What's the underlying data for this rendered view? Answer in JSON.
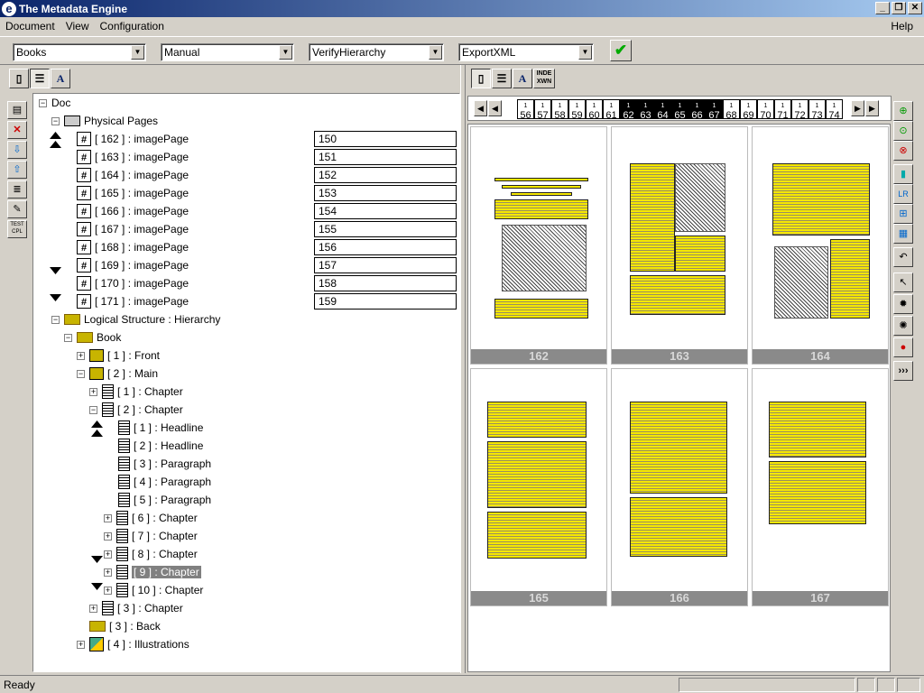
{
  "window": {
    "title": "The Metadata Engine",
    "app_icon": "e"
  },
  "menu": {
    "document": "Document",
    "view": "View",
    "configuration": "Configuration",
    "help": "Help"
  },
  "toolbar": {
    "combos": [
      {
        "value": "Books"
      },
      {
        "value": "Manual"
      },
      {
        "value": "VerifyHierarchy"
      },
      {
        "value": "ExportXML"
      }
    ]
  },
  "tree": {
    "root": "Doc",
    "physical": "Physical Pages",
    "pages": [
      {
        "label": "[ 162 ] : imagePage",
        "value": "150"
      },
      {
        "label": "[ 163 ] : imagePage",
        "value": "151"
      },
      {
        "label": "[ 164 ] : imagePage",
        "value": "152"
      },
      {
        "label": "[ 165 ] : imagePage",
        "value": "153"
      },
      {
        "label": "[ 166 ] : imagePage",
        "value": "154"
      },
      {
        "label": "[ 167 ] : imagePage",
        "value": "155"
      },
      {
        "label": "[ 168 ] : imagePage",
        "value": "156"
      },
      {
        "label": "[ 169 ] : imagePage",
        "value": "157"
      },
      {
        "label": "[ 170 ] : imagePage",
        "value": "158"
      },
      {
        "label": "[ 171 ] : imagePage",
        "value": "159"
      }
    ],
    "logical": "Logical Structure : Hierarchy",
    "book": "Book",
    "front": "[ 1 ] : Front",
    "main": "[ 2 ] : Main",
    "chapter1": "[ 1 ] : Chapter",
    "chapter2": "[ 2 ] : Chapter",
    "sub": [
      "[ 1 ] : Headline",
      "[ 2 ] : Headline",
      "[ 3 ] : Paragraph",
      "[ 4 ] : Paragraph",
      "[ 5 ] : Paragraph"
    ],
    "chapters": [
      "[ 6 ] : Chapter",
      "[ 7 ] : Chapter",
      "[ 8 ] : Chapter",
      "[ 9 ] : Chapter",
      "[ 10 ] : Chapter"
    ],
    "chapter3": "[ 3 ] : Chapter",
    "back": "[ 3 ] : Back",
    "illustrations": "[ 4 ] : Illustrations"
  },
  "right_tabs": {
    "index": "INDE XWN"
  },
  "thumb_numbers": [
    "56",
    "57",
    "58",
    "59",
    "60",
    "61",
    "62",
    "63",
    "64",
    "65",
    "66",
    "67",
    "68",
    "69",
    "70",
    "71",
    "72",
    "73",
    "74"
  ],
  "dark_range": [
    6,
    11
  ],
  "pages_view": [
    {
      "label": "162"
    },
    {
      "label": "163"
    },
    {
      "label": "164"
    },
    {
      "label": "165"
    },
    {
      "label": "166"
    },
    {
      "label": "167"
    }
  ],
  "left_tool_text": "TEST CPL",
  "status": {
    "text": "Ready"
  }
}
